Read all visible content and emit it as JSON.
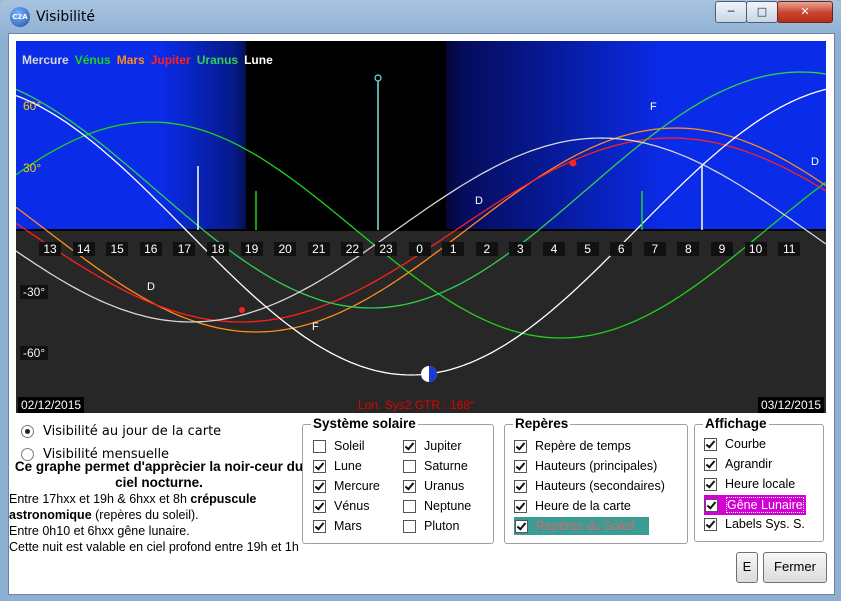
{
  "window": {
    "title": "Visibilité",
    "app_badge": "C2A"
  },
  "chart": {
    "legend": [
      {
        "name": "Mercure",
        "color": "#d8d8d8"
      },
      {
        "name": "Vénus",
        "color": "#1fd21f"
      },
      {
        "name": "Mars",
        "color": "#ff8c1a"
      },
      {
        "name": "Jupiter",
        "color": "#ff2020"
      },
      {
        "name": "Uranus",
        "color": "#30d050"
      },
      {
        "name": "Lune",
        "color": "#ffffff"
      }
    ],
    "y_labels": [
      "60°",
      "30°",
      "-30°",
      "-60°"
    ],
    "hours": [
      "13",
      "14",
      "15",
      "16",
      "17",
      "18",
      "19",
      "20",
      "21",
      "22",
      "23",
      "0",
      "1",
      "2",
      "3",
      "4",
      "5",
      "6",
      "7",
      "8",
      "9",
      "10",
      "11"
    ],
    "marks": [
      "D",
      "F",
      "D",
      "F",
      "D"
    ],
    "date_left": "02/12/2015",
    "date_right": "03/12/2015",
    "longitude_text": "Lon. Sys2 GTR : 168°"
  },
  "options": {
    "radio_day": "Visibilité au jour de la carte",
    "radio_month": "Visibilité mensuelle",
    "radio_selected": "day"
  },
  "info": {
    "bold_title": "Ce graphe permet d'apprècier la noir-ceur du ciel nocturne.",
    "line1_pre": "Entre 17hxx et 19h & 6hxx et 8h ",
    "line1_bold": "crépuscule astronomique",
    "line1_post": " (repères du soleil).",
    "line2": "Entre 0h10 et 6hxx gêne lunaire.",
    "line3": "Cette nuit est valable en ciel profond entre 19h et 1h"
  },
  "solar_system": {
    "title": "Système solaire",
    "left": [
      {
        "label": "Soleil",
        "checked": false
      },
      {
        "label": "Lune",
        "checked": true
      },
      {
        "label": "Mercure",
        "checked": true
      },
      {
        "label": "Vénus",
        "checked": true
      },
      {
        "label": "Mars",
        "checked": true
      }
    ],
    "right": [
      {
        "label": "Jupiter",
        "checked": true
      },
      {
        "label": "Saturne",
        "checked": false
      },
      {
        "label": "Uranus",
        "checked": true
      },
      {
        "label": "Neptune",
        "checked": false
      },
      {
        "label": "Pluton",
        "checked": false
      }
    ]
  },
  "reperes": {
    "title": "Repères",
    "items": [
      {
        "label": "Repère de temps",
        "checked": true
      },
      {
        "label": "Hauteurs (principales)",
        "checked": true
      },
      {
        "label": "Hauteurs (secondaires)",
        "checked": true
      },
      {
        "label": "Heure de la carte",
        "checked": true
      },
      {
        "label": "Repères du Soleil",
        "checked": true
      }
    ]
  },
  "affichage": {
    "title": "Affichage",
    "items": [
      {
        "label": "Courbe",
        "checked": true
      },
      {
        "label": "Agrandir",
        "checked": true
      },
      {
        "label": "Heure locale",
        "checked": true
      },
      {
        "label": "Gêne Lunaire",
        "checked": true
      },
      {
        "label": "Labels Sys. S.",
        "checked": true
      }
    ]
  },
  "buttons": {
    "e_label": "E",
    "close_label": "Fermer"
  }
}
